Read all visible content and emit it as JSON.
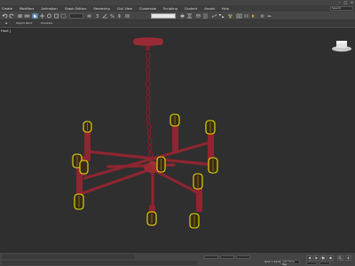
{
  "menu": {
    "items": [
      "Create",
      "Modifiers",
      "Animation",
      "Graph Editors",
      "Rendering",
      "Civil View",
      "Customize",
      "Scripting",
      "Content",
      "Arnold",
      "Help"
    ],
    "search_placeholder": "Search"
  },
  "ribbon": {
    "tabs": [
      "Object Paint",
      "Populate"
    ]
  },
  "viewport": {
    "label": "Front ]"
  },
  "statusbar": {
    "grid": "Grid = 10.0mm",
    "time_tag": "Add Time Tag"
  },
  "colors": {
    "model": "#8e2530",
    "selection": "#e8e200",
    "accent": "#5b7fa3"
  },
  "icons": [
    "undo-icon",
    "redo-icon",
    "link-icon",
    "unlink-icon",
    "bind-icon",
    "select-icon",
    "region-select-icon",
    "move-icon",
    "rotate-icon",
    "scale-icon",
    "snap-icon",
    "angle-snap-icon",
    "mirror-icon",
    "align-icon",
    "layer-icon",
    "curve-editor-icon",
    "material-editor-icon",
    "render-setup-icon",
    "render-icon",
    "viewcube-icon",
    "play-icon"
  ]
}
